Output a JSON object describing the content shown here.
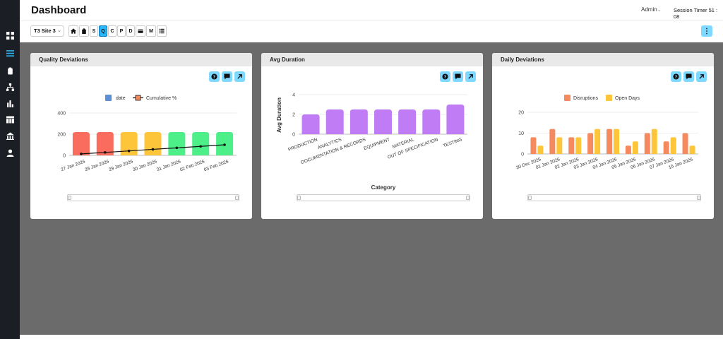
{
  "header": {
    "title": "Dashboard",
    "user": "Admin",
    "session_timer": "Session Timer 51 : 08"
  },
  "toolbar": {
    "site": "T3 Site 3",
    "buttons": [
      {
        "label": "",
        "icon": "home-icon"
      },
      {
        "label": "",
        "icon": "clipboard-icon"
      },
      {
        "label": "S",
        "icon": ""
      },
      {
        "label": "Q",
        "icon": "",
        "active": true
      },
      {
        "label": "C",
        "icon": ""
      },
      {
        "label": "P",
        "icon": ""
      },
      {
        "label": "D",
        "icon": ""
      },
      {
        "label": "",
        "icon": "card-icon"
      },
      {
        "label": "M",
        "icon": ""
      },
      {
        "label": "",
        "icon": "list-icon"
      }
    ],
    "menu_label": "⋮"
  },
  "sidebar": {
    "items": [
      "grid-icon",
      "menu-icon",
      "clipboard-icon",
      "sitemap-icon",
      "bar-chart-icon",
      "table-icon",
      "building-icon",
      "user-icon"
    ],
    "active_index": 1
  },
  "colors": {
    "accent": "#7fd8ff",
    "red": "#fa6d5e",
    "yellow": "#fdc53a",
    "green": "#4def89",
    "purple": "#bf7cf5",
    "orange": "#f58a5f",
    "gold": "#fdc53a"
  },
  "chart_data": [
    {
      "type": "bar",
      "title": "Quality Deviations",
      "legend": [
        "date",
        "Cumulative %"
      ],
      "categories": [
        "27 Jan 2026",
        "28 Jan 2026",
        "29 Jan 2026",
        "30 Jan 2026",
        "31 Jan 2026",
        "02 Feb 2026",
        "03 Feb 2026"
      ],
      "series": [
        {
          "name": "date",
          "values": [
            220,
            220,
            220,
            220,
            220,
            220,
            220
          ],
          "colors": [
            "#fa6d5e",
            "#fa6d5e",
            "#fdc53a",
            "#fdc53a",
            "#4def89",
            "#4def89",
            "#4def89"
          ]
        },
        {
          "name": "Cumulative %",
          "type": "line",
          "values": [
            14,
            28,
            42,
            57,
            71,
            85,
            100
          ]
        }
      ],
      "yticks": [
        0,
        200,
        400
      ],
      "ylim": [
        0,
        400
      ],
      "xlabel": "",
      "ylabel": ""
    },
    {
      "type": "bar",
      "title": "Avg Duration",
      "categories": [
        "PRODUCTION",
        "ANALYTICS",
        "DOCUMENTATION & RECORDS",
        "EQUIPMENT",
        "MATERIAL",
        "OUT OF SPECIFICATION",
        "TESTING"
      ],
      "values": [
        2,
        2.5,
        2.5,
        2.5,
        2.5,
        2.5,
        3
      ],
      "yticks": [
        0,
        2,
        4
      ],
      "ylim": [
        0,
        4
      ],
      "xlabel": "Category",
      "ylabel": "Avg Duration"
    },
    {
      "type": "bar",
      "title": "Daily Deviations",
      "legend": [
        "Disruptions",
        "Open Days"
      ],
      "categories": [
        "30 Dec 2025",
        "01 Jan 2026",
        "02 Jan 2026",
        "03 Jan 2026",
        "04 Jan 2026",
        "05 Jan 2026",
        "06 Jan 2026",
        "07 Jan 2026",
        "15 Jan 2026"
      ],
      "series": [
        {
          "name": "Disruptions",
          "values": [
            8,
            12,
            8,
            10,
            12,
            4,
            10,
            6,
            10
          ]
        },
        {
          "name": "Open Days",
          "values": [
            4,
            8,
            8,
            12,
            12,
            6,
            12,
            8,
            4
          ]
        }
      ],
      "yticks": [
        0,
        10,
        20
      ],
      "ylim": [
        0,
        20
      ],
      "xlabel": "",
      "ylabel": ""
    }
  ]
}
